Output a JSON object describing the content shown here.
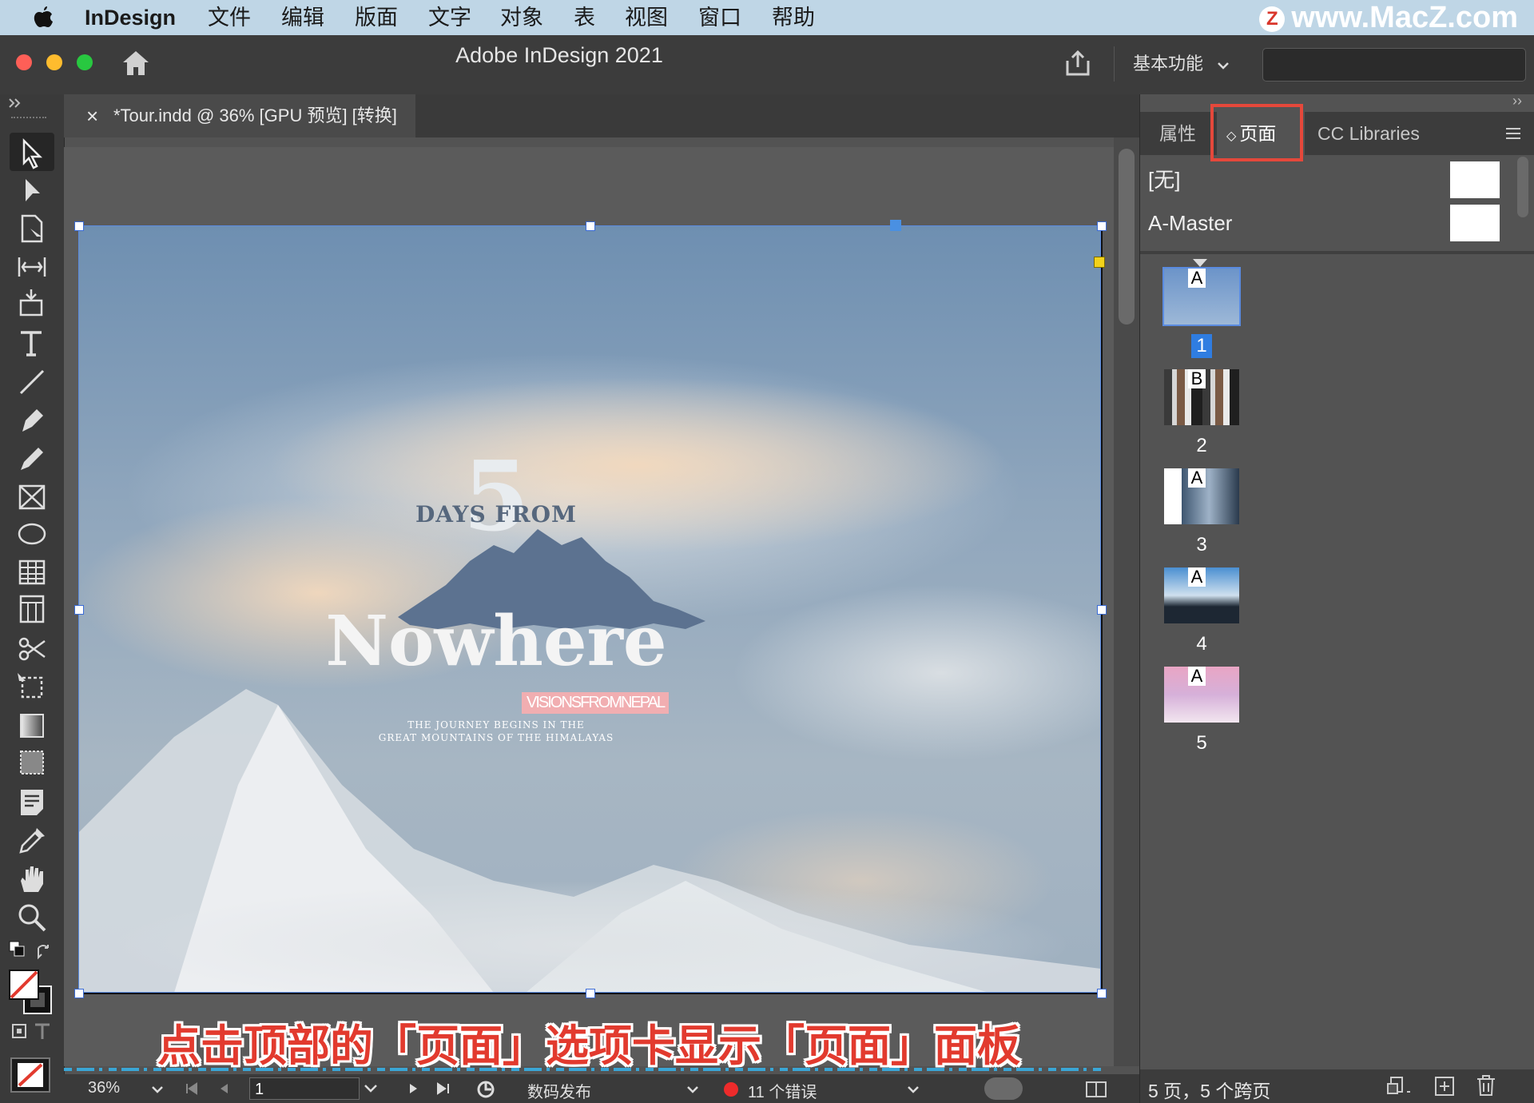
{
  "menubar": {
    "app_name": "InDesign",
    "items": [
      "文件",
      "编辑",
      "版面",
      "文字",
      "对象",
      "表",
      "视图",
      "窗口",
      "帮助"
    ],
    "watermark": "www.MacZ.com",
    "watermark_badge": "Z"
  },
  "window": {
    "title": "Adobe InDesign 2021",
    "workspace": "基本功能"
  },
  "document_tab": {
    "close": "×",
    "label": "*Tour.indd @ 36% [GPU 预览] [转换]"
  },
  "artwork": {
    "number": "5",
    "days_from": "DAYS FROM",
    "nowhere": "Nowhere",
    "vision": "VISIONSFROMNEPAL",
    "tagline_1": "THE JOURNEY BEGINS IN THE",
    "tagline_2": "GREAT MOUNTAINS OF THE HIMALAYAS"
  },
  "instruction": "点击顶部的「页面」选项卡显示「页面」面板",
  "statusbar": {
    "zoom": "36%",
    "page": "1",
    "preflight_profile": "数码发布",
    "errors": "11 个错误"
  },
  "panel": {
    "collapse": "››",
    "tabs": {
      "properties": "属性",
      "pages": "页面",
      "pages_indicator": "◇",
      "cc_libraries": "CC Libraries"
    },
    "masters": [
      "[无]",
      "A-Master"
    ],
    "pages": [
      {
        "number": "1",
        "master": "A"
      },
      {
        "number": "2",
        "master": "B"
      },
      {
        "number": "3",
        "master": "A"
      },
      {
        "number": "4",
        "master": "A"
      },
      {
        "number": "5",
        "master": "A"
      }
    ],
    "footer": "5 页，5 个跨页"
  },
  "colors": {
    "accent_red": "#e5483b",
    "selection_blue": "#3a6bd6",
    "close": "#fe5f57",
    "minimize": "#febc2e",
    "zoom": "#28c840",
    "error_dot": "#ee2b2b"
  }
}
